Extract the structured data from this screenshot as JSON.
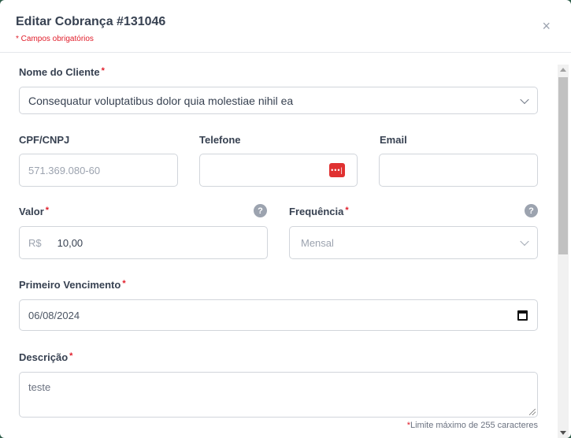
{
  "modal": {
    "title": "Editar Cobrança #131046",
    "required_note": "* Campos obrigatórios",
    "close_glyph": "×"
  },
  "fields": {
    "client": {
      "label": "Nome do Cliente",
      "required_marker": "*",
      "value": "Consequatur voluptatibus dolor quia molestiae nihil ea"
    },
    "cpf": {
      "label": "CPF/CNPJ",
      "placeholder": "571.369.080-60"
    },
    "phone": {
      "label": "Telefone",
      "value": "",
      "icon": "password-manager-icon",
      "icon_glyph": "•••|"
    },
    "email": {
      "label": "Email",
      "value": ""
    },
    "valor": {
      "label": "Valor",
      "required_marker": "*",
      "prefix": "R$",
      "value": "10,00",
      "help_glyph": "?"
    },
    "frequencia": {
      "label": "Frequência",
      "required_marker": "*",
      "value": "Mensal",
      "help_glyph": "?"
    },
    "vencimento": {
      "label": "Primeiro Vencimento",
      "required_marker": "*",
      "value": "06/08/2024"
    },
    "descricao": {
      "label": "Descrição",
      "required_marker": "*",
      "value": "teste",
      "limit_marker": "*",
      "limit_note": "Limite máximo de 255 caracteres"
    }
  },
  "colors": {
    "required": "#e11d2a",
    "border": "#d1d5db",
    "text": "#374151",
    "muted": "#9ca3af"
  }
}
